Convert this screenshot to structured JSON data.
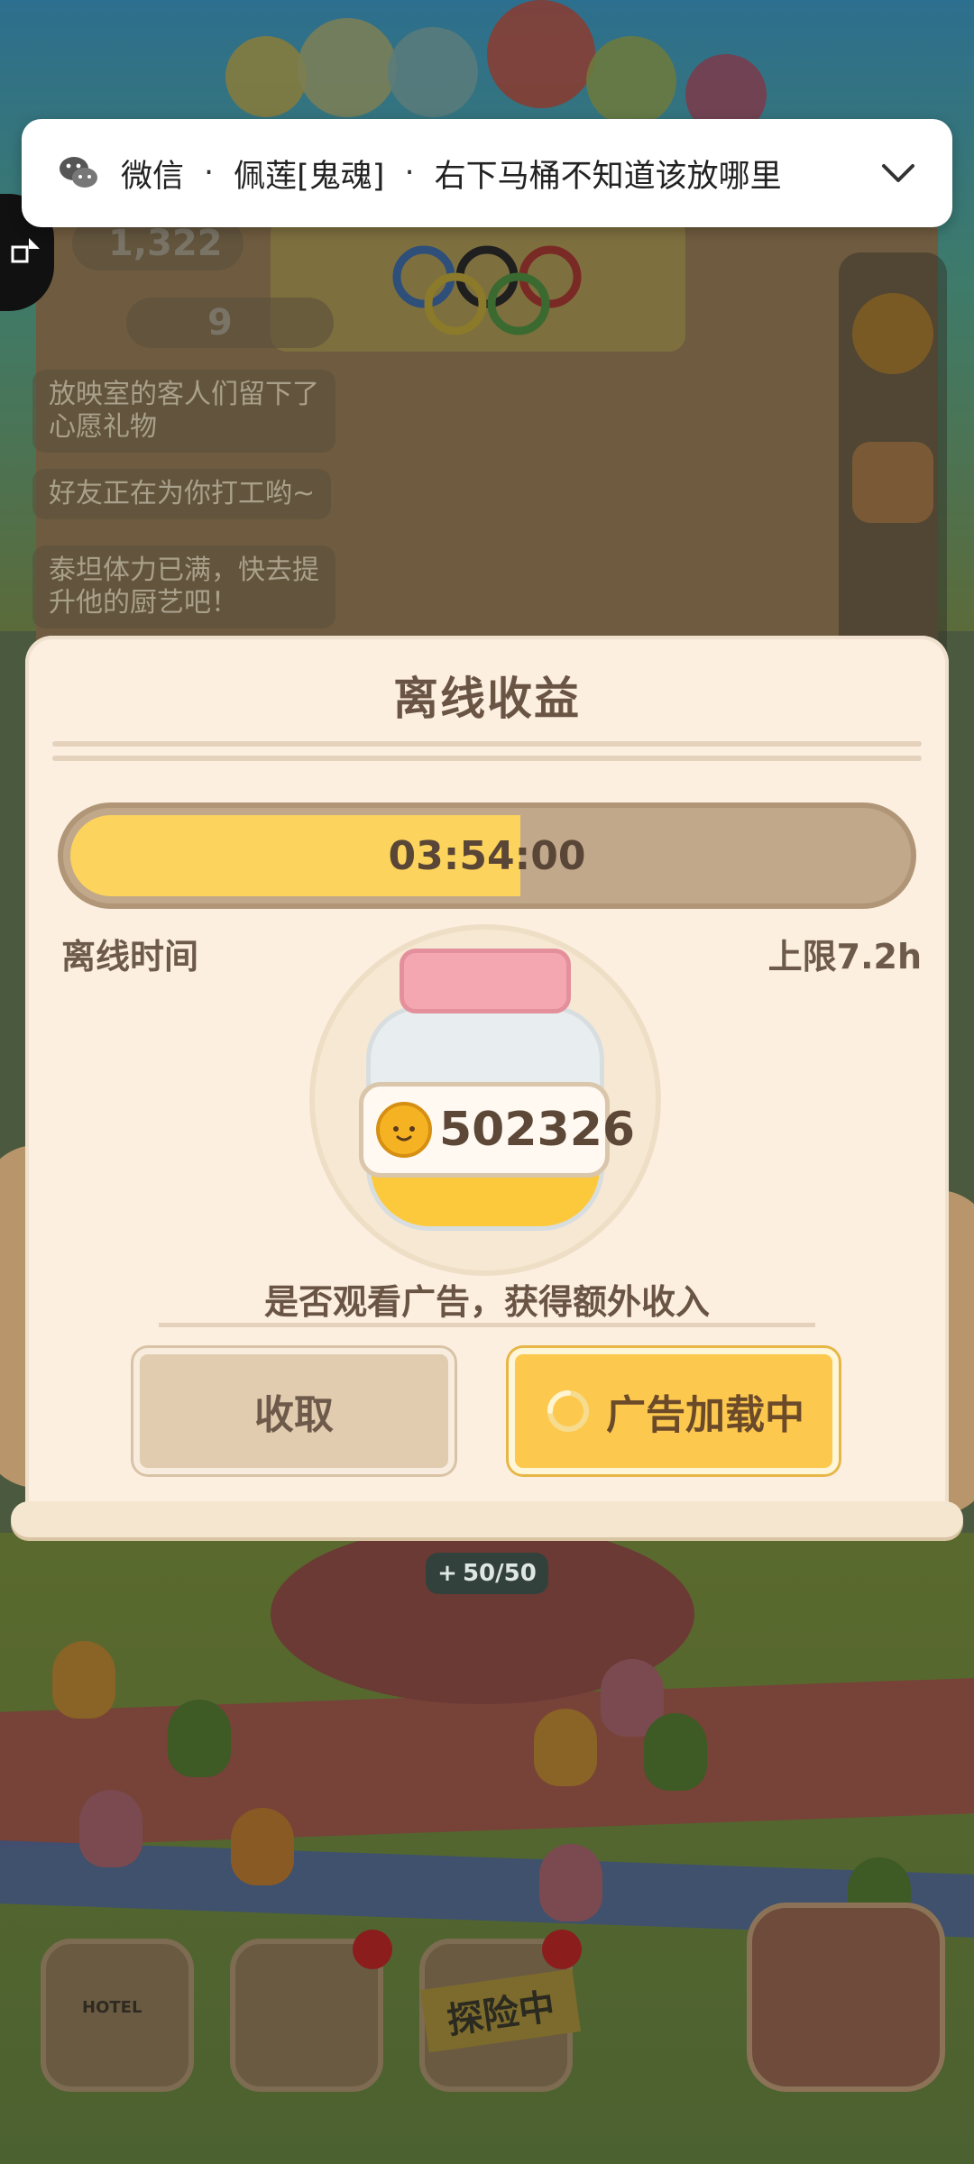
{
  "notification": {
    "app": "微信",
    "sender": "佩莲[鬼魂]",
    "message": "右下马桶不知道该放哪里",
    "separator": "·"
  },
  "hud": {
    "coins": "1,322",
    "fans": "9"
  },
  "chat_messages": [
    "放映室的客人们留下了\n心愿礼物",
    "好友正在为你打工哟~",
    "泰坦体力已满，快去提\n升他的厨艺吧！"
  ],
  "dialog": {
    "title": "离线收益",
    "offline_time": "03:54:00",
    "progress_fraction": 0.54,
    "offline_time_label": "离线时间",
    "limit_label": "上限7.2h",
    "earnings": "502326",
    "ad_question": "是否观看广告，获得额外收入",
    "collect_button": "收取",
    "ad_button": "广告加载中"
  },
  "stage": {
    "energy": "50/50"
  },
  "bottom_nav": {
    "explore_label": "探险中",
    "hotel_label": "HOTEL"
  },
  "colors": {
    "accent_yellow": "#fcc84e",
    "paper": "#fcefe0",
    "text_brown": "#6a5545"
  }
}
